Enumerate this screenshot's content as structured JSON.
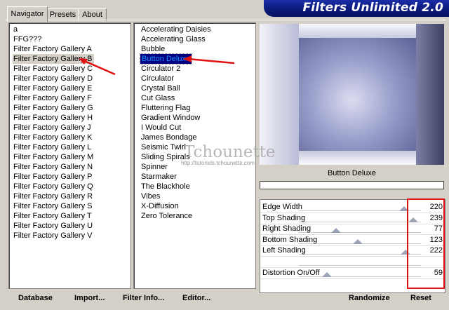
{
  "header": {
    "title": "Filters Unlimited 2.0"
  },
  "tabs": [
    {
      "label": "Navigator",
      "active": true
    },
    {
      "label": "Presets",
      "active": false
    },
    {
      "label": "About",
      "active": false
    }
  ],
  "categories": [
    "a",
    "FFG???",
    "Filter Factory Gallery A",
    "Filter Factory Gallery B",
    "Filter Factory Gallery C",
    "Filter Factory Gallery D",
    "Filter Factory Gallery E",
    "Filter Factory Gallery F",
    "Filter Factory Gallery G",
    "Filter Factory Gallery H",
    "Filter Factory Gallery J",
    "Filter Factory Gallery K",
    "Filter Factory Gallery L",
    "Filter Factory Gallery M",
    "Filter Factory Gallery N",
    "Filter Factory Gallery P",
    "Filter Factory Gallery Q",
    "Filter Factory Gallery R",
    "Filter Factory Gallery S",
    "Filter Factory Gallery T",
    "Filter Factory Gallery U",
    "Filter Factory Gallery V"
  ],
  "selected_category": "Filter Factory Gallery B",
  "filters": [
    "Accelerating Daisies",
    "Accelerating Glass",
    "Bubble",
    "Button Deluxe",
    "Circulator 2",
    "Circulator",
    "Crystal Ball",
    "Cut Glass",
    "Fluttering Flag",
    "Gradient Window",
    "I Would Cut",
    "James Bondage",
    "Seismic Twirl",
    "Sliding Spirals",
    "Spinner",
    "Starmaker",
    "The Blackhole",
    "Vibes",
    "X-Diffusion",
    "Zero Tolerance"
  ],
  "selected_filter": "Button Deluxe",
  "preview": {
    "filter_name": "Button Deluxe"
  },
  "parameters": [
    {
      "label": "Edge Width",
      "value": "220",
      "level": 0.863
    },
    {
      "label": "Top Shading",
      "value": "239",
      "level": 0.937
    },
    {
      "label": "Right Shading",
      "value": "77",
      "level": 0.302
    },
    {
      "label": "Bottom Shading",
      "value": "123",
      "level": 0.482
    },
    {
      "label": "Left Shading",
      "value": "222",
      "level": 0.871
    },
    {
      "label": "",
      "value": "",
      "level": null
    },
    {
      "label": "Distortion On/Off",
      "value": "59",
      "level": 0.231
    }
  ],
  "watermark": {
    "text": "Tchounette",
    "url": "http://tutoriels.tchounette.com"
  },
  "buttons": {
    "database": "Database",
    "import": "Import...",
    "filter_info": "Filter Info...",
    "editor": "Editor...",
    "randomize": "Randomize",
    "reset": "Reset"
  },
  "colors": {
    "banner": "#0a1878",
    "selection": "#000080",
    "annotation": "#e01010"
  }
}
